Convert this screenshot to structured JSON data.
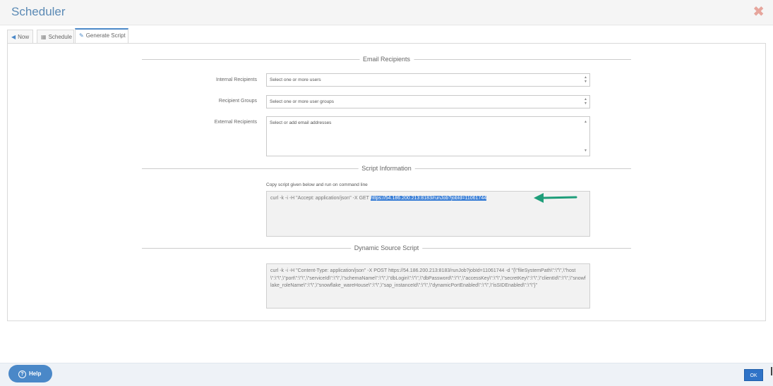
{
  "header": {
    "title": "Scheduler",
    "close_label": "✖"
  },
  "tabs": [
    {
      "label": "Now",
      "icon": "send-icon"
    },
    {
      "label": "Schedule",
      "icon": "calendar-icon"
    },
    {
      "label": "Generate Script",
      "icon": "script-icon",
      "active": true
    }
  ],
  "email": {
    "section_title": "Email Recipients",
    "internal": {
      "label": "Internal Recipients",
      "placeholder": "Select one or more users"
    },
    "groups": {
      "label": "Recipient Groups",
      "placeholder": "Select one or more user groups"
    },
    "external": {
      "label": "External Recipients",
      "placeholder": "Select or add email addresses"
    }
  },
  "script_info": {
    "section_title": "Script Information",
    "note": "Copy script given below and run on command line",
    "command_prefix": "curl -k -i -H \"Accept: application/json\" -X GET ",
    "command_url": "https://54.186.200.213:8183/runJob?jobId=11061744"
  },
  "dynamic": {
    "section_title": "Dynamic Source Script",
    "script": "curl -k -i -H \"Content-Type: application/json\" -X POST https://54.186.200.213:8183/runJob?jobId=11061744 -d \"{\\\"fileSystemPath\\\":\\\"\\\",\\\"host\\\":\\\"\\\",\\\"port\\\":\\\"\\\",\\\"serviceId\\\":\\\"\\\",\\\"schemaName\\\":\\\"\\\",\\\"dbLogin\\\":\\\"\\\",\\\"dbPassword\\\":\\\"\\\",\\\"accessKey\\\":\\\"\\\",\\\"secretKey\\\":\\\"\\\",\\\"clientId\\\":\\\"\\\",\\\"snowflake_roleName\\\":\\\"\\\",\\\"snowflake_wareHouse\\\":\\\"\\\",\\\"sap_instanceId\\\":\\\"\\\",\\\"dynamicPortEnabled\\\":\\\"\\\",\\\"isSIDEnabled\\\":\\\"\\\"}\""
  },
  "footer": {
    "help_label": "Help",
    "ok_label": "OK"
  },
  "colors": {
    "accent": "#4a88c8",
    "arrow": "#1f9e7a",
    "selection": "#3b7fd6"
  }
}
